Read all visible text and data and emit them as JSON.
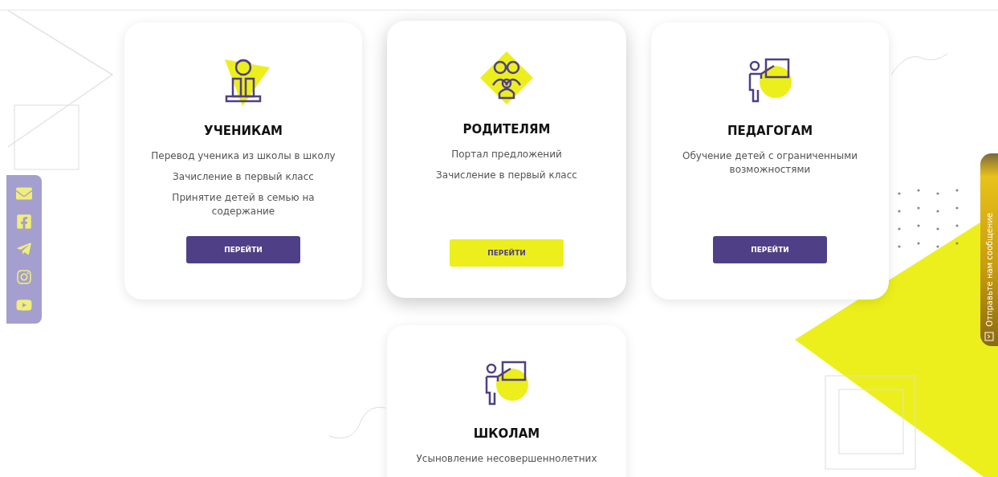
{
  "cards": [
    {
      "kind": "student",
      "title": "УЧЕНИКАМ",
      "links": [
        "Перевод ученика из школы в школу",
        "Зачисление в первый класс",
        "Принятие детей в семью на содержание"
      ],
      "button": "ПЕРЕЙТИ",
      "selected": false
    },
    {
      "kind": "parents",
      "title": "РОДИТЕЛЯМ",
      "links": [
        "Портал предложений",
        "Зачисление в первый класс"
      ],
      "button": "ПЕРЕЙТИ",
      "selected": true
    },
    {
      "kind": "teacher",
      "title": "ПЕДАГОГАМ",
      "links": [
        "Обучение детей с ограниченными возможностями"
      ],
      "button": "ПЕРЕЙТИ",
      "selected": false
    },
    {
      "kind": "teacher",
      "title": "ШКОЛАМ",
      "links": [
        "Усыновление несовершеннолетних"
      ],
      "selected": false
    }
  ],
  "social": [
    {
      "kind": "mail"
    },
    {
      "kind": "facebook"
    },
    {
      "kind": "telegram"
    },
    {
      "kind": "instagram"
    },
    {
      "kind": "youtube"
    }
  ],
  "feedback_tab": {
    "label": "Отправьте нам сообщение"
  }
}
